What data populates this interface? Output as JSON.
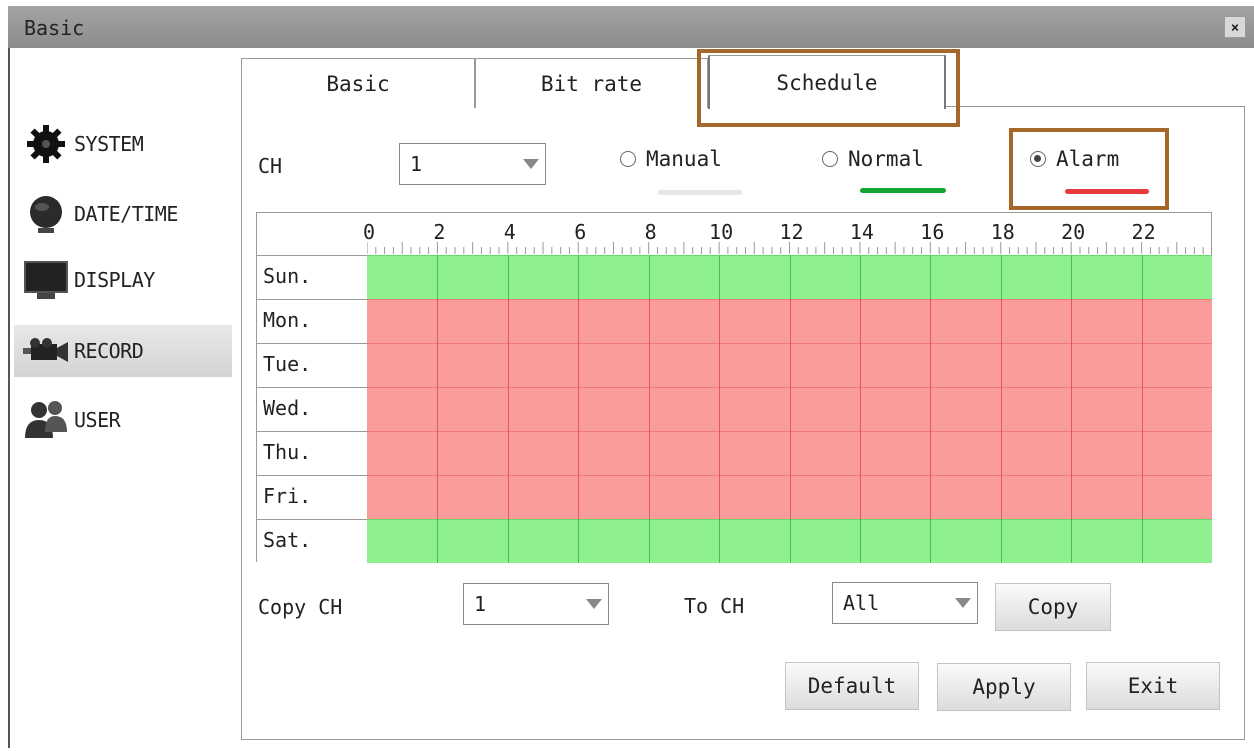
{
  "window": {
    "title": "Basic",
    "close_glyph": "×"
  },
  "sidebar": {
    "items": [
      {
        "label": "SYSTEM",
        "icon": "gear-icon"
      },
      {
        "label": "DATE/TIME",
        "icon": "globe-icon"
      },
      {
        "label": "DISPLAY",
        "icon": "monitor-icon"
      },
      {
        "label": "RECORD",
        "icon": "camera-icon",
        "active": true
      },
      {
        "label": "USER",
        "icon": "users-icon"
      }
    ]
  },
  "tabs": [
    {
      "label": "Basic"
    },
    {
      "label": "Bit rate"
    },
    {
      "label": "Schedule",
      "selected": true
    }
  ],
  "channel": {
    "label": "CH",
    "value": "1"
  },
  "modes": [
    {
      "label": "Manual",
      "selected": false,
      "color": "#e6e6e6"
    },
    {
      "label": "Normal",
      "selected": false,
      "color": "#16a534"
    },
    {
      "label": "Alarm",
      "selected": true,
      "color": "#e83a3a"
    }
  ],
  "schedule": {
    "hour_labels": [
      "0",
      "2",
      "4",
      "6",
      "8",
      "10",
      "12",
      "14",
      "16",
      "18",
      "20",
      "22"
    ],
    "days": [
      {
        "label": "Sun.",
        "mode": "Normal"
      },
      {
        "label": "Mon.",
        "mode": "Alarm"
      },
      {
        "label": "Tue.",
        "mode": "Alarm"
      },
      {
        "label": "Wed.",
        "mode": "Alarm"
      },
      {
        "label": "Thu.",
        "mode": "Alarm"
      },
      {
        "label": "Fri.",
        "mode": "Alarm"
      },
      {
        "label": "Sat.",
        "mode": "Normal"
      }
    ],
    "colors": {
      "Normal": "#8ef08e",
      "Alarm": "#fb9c9c"
    }
  },
  "copy": {
    "copy_ch_label": "Copy CH",
    "copy_ch_value": "1",
    "to_ch_label": "To CH",
    "to_ch_value": "All",
    "copy_button": "Copy"
  },
  "footer": {
    "default_button": "Default",
    "apply_button": "Apply",
    "exit_button": "Exit"
  },
  "highlight_color": "#a5682a"
}
